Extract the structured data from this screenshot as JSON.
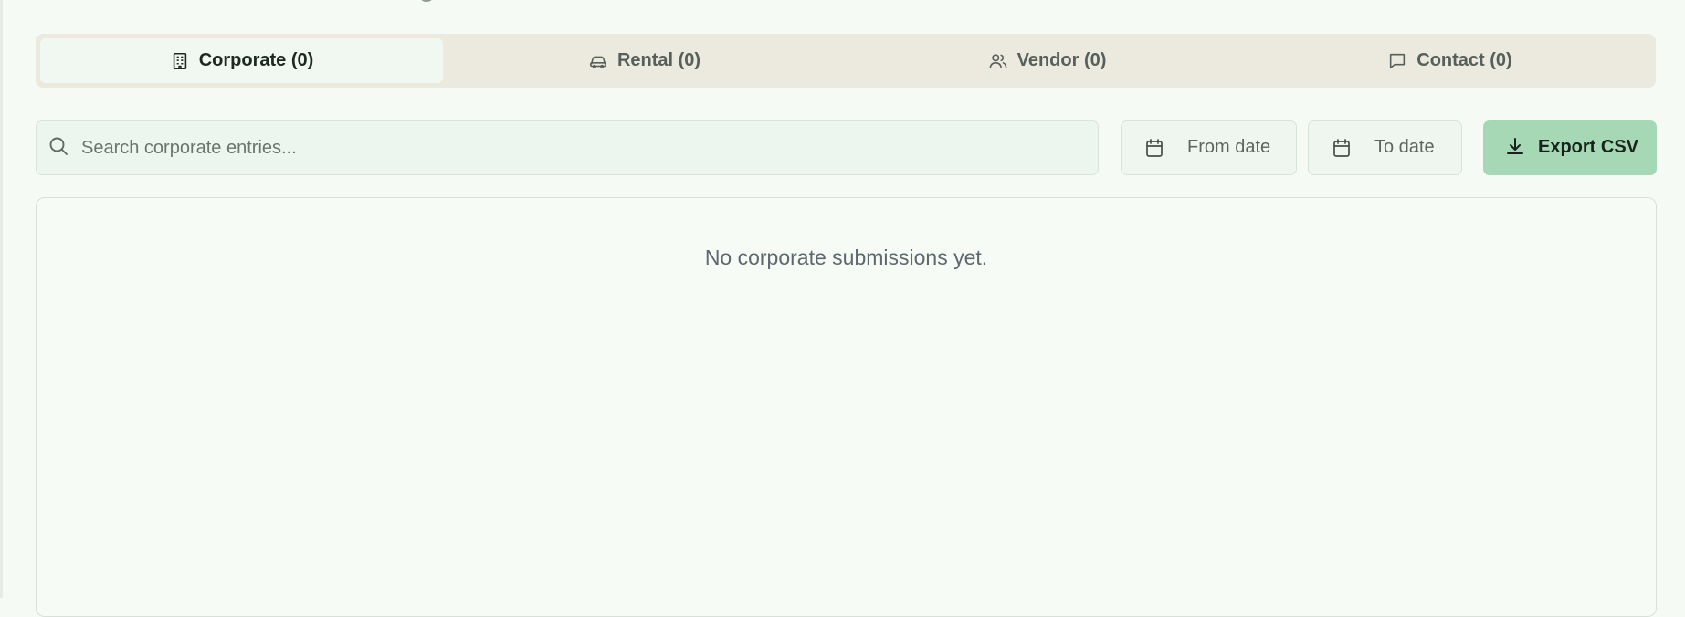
{
  "tabs": [
    {
      "label": "Corporate (0)",
      "icon": "building-icon",
      "active": true
    },
    {
      "label": "Rental (0)",
      "icon": "car-icon",
      "active": false
    },
    {
      "label": "Vendor (0)",
      "icon": "users-icon",
      "active": false
    },
    {
      "label": "Contact (0)",
      "icon": "message-icon",
      "active": false
    }
  ],
  "search": {
    "placeholder": "Search corporate entries...",
    "value": ""
  },
  "filters": {
    "from_label": "From date",
    "to_label": "To date"
  },
  "actions": {
    "export_label": "Export CSV"
  },
  "table": {
    "empty_message": "No corporate submissions yet."
  },
  "colors": {
    "background": "#f6faf5",
    "tab_bar": "#ece9df",
    "active_tab": "#f1f8f1",
    "export_button": "#a7d8b6"
  }
}
